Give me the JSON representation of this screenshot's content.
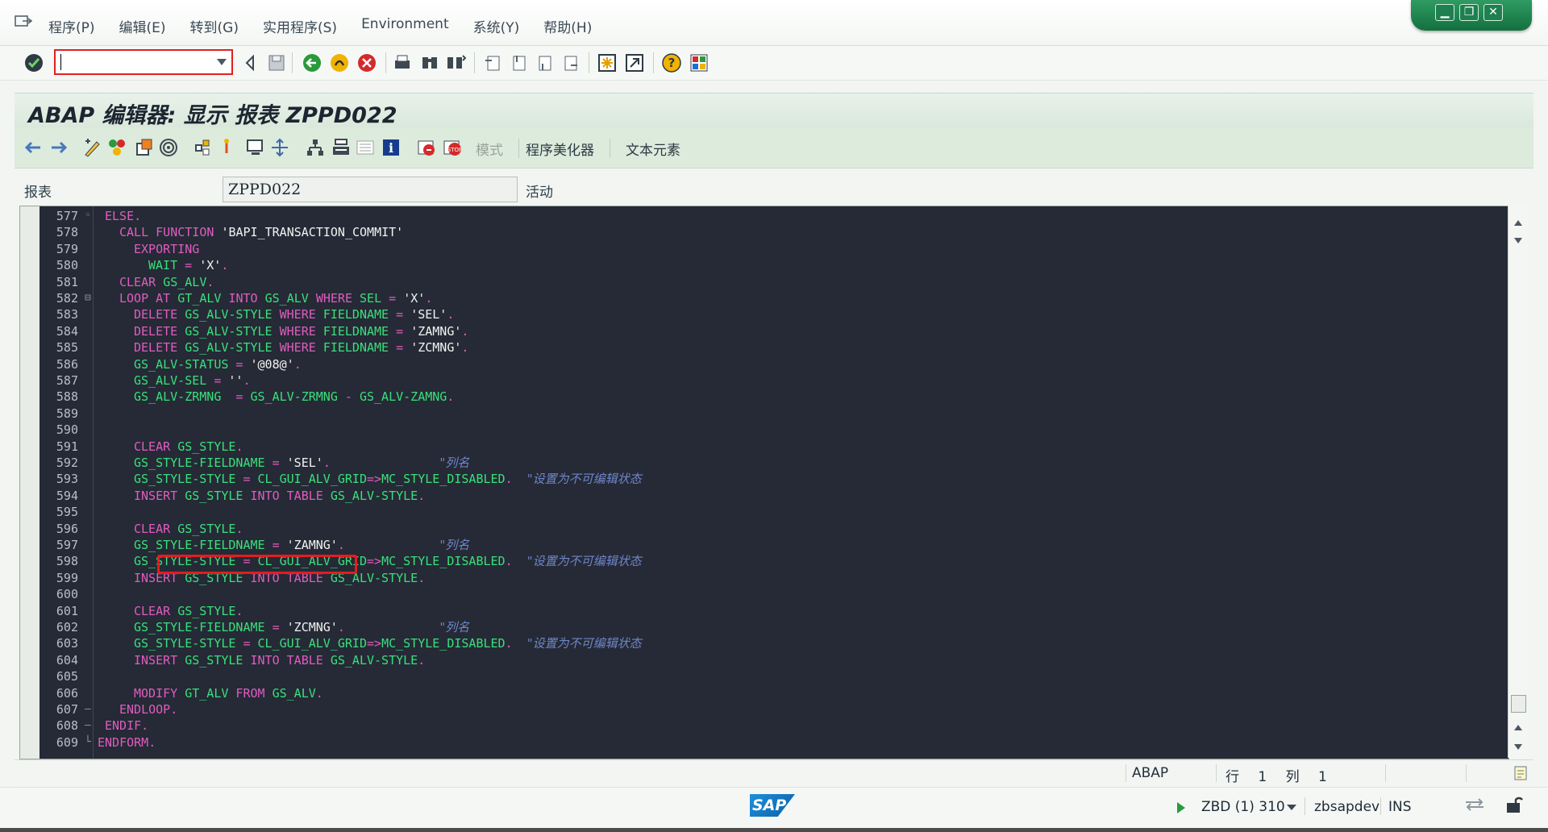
{
  "menu": {
    "items": [
      "程序(P)",
      "编辑(E)",
      "转到(G)",
      "实用程序(S)",
      "Environment",
      "系统(Y)",
      "帮助(H)"
    ]
  },
  "window_controls": {
    "minimize": "▁",
    "restore": "❐",
    "close": "✕"
  },
  "command_field": {
    "value": ""
  },
  "title": "ABAP 编辑器: 显示 报表 ZPPD022",
  "app_toolbar": {
    "mode_label": "模式",
    "pretty_printer_label": "程序美化器",
    "text_elements_label": "文本元素"
  },
  "header": {
    "label": "报表",
    "program_name": "ZPPD022",
    "status": "活动"
  },
  "code_lines": [
    {
      "n": "577",
      "fold": "◦",
      "indent": 1,
      "parts": [
        {
          "t": "kw",
          "v": "ELSE."
        }
      ]
    },
    {
      "n": "578",
      "fold": "",
      "indent": 3,
      "parts": [
        {
          "t": "kw",
          "v": "CALL FUNCTION "
        },
        {
          "t": "str",
          "v": "'BAPI_TRANSACTION_COMMIT'"
        }
      ]
    },
    {
      "n": "579",
      "fold": "",
      "indent": 5,
      "parts": [
        {
          "t": "kw",
          "v": "EXPORTING"
        }
      ]
    },
    {
      "n": "580",
      "fold": "",
      "indent": 7,
      "parts": [
        {
          "t": "id",
          "v": "WAIT"
        },
        {
          "t": "kw",
          "v": " = "
        },
        {
          "t": "str",
          "v": "'X'"
        },
        {
          "t": "kw",
          "v": "."
        }
      ]
    },
    {
      "n": "581",
      "fold": "",
      "indent": 3,
      "parts": [
        {
          "t": "kw",
          "v": "CLEAR "
        },
        {
          "t": "id",
          "v": "GS_ALV"
        },
        {
          "t": "kw",
          "v": "."
        }
      ]
    },
    {
      "n": "582",
      "fold": "⊟",
      "indent": 3,
      "parts": [
        {
          "t": "kw",
          "v": "LOOP AT "
        },
        {
          "t": "id",
          "v": "GT_ALV"
        },
        {
          "t": "kw",
          "v": " INTO "
        },
        {
          "t": "id",
          "v": "GS_ALV"
        },
        {
          "t": "kw",
          "v": " WHERE "
        },
        {
          "t": "id",
          "v": "SEL"
        },
        {
          "t": "kw",
          "v": " = "
        },
        {
          "t": "str",
          "v": "'X'"
        },
        {
          "t": "kw",
          "v": "."
        }
      ]
    },
    {
      "n": "583",
      "fold": "",
      "indent": 5,
      "parts": [
        {
          "t": "kw",
          "v": "DELETE "
        },
        {
          "t": "id",
          "v": "GS_ALV-STYLE"
        },
        {
          "t": "kw",
          "v": " WHERE "
        },
        {
          "t": "id",
          "v": "FIELDNAME"
        },
        {
          "t": "kw",
          "v": " = "
        },
        {
          "t": "str",
          "v": "'SEL'"
        },
        {
          "t": "kw",
          "v": "."
        }
      ]
    },
    {
      "n": "584",
      "fold": "",
      "indent": 5,
      "parts": [
        {
          "t": "kw",
          "v": "DELETE "
        },
        {
          "t": "id",
          "v": "GS_ALV-STYLE"
        },
        {
          "t": "kw",
          "v": " WHERE "
        },
        {
          "t": "id",
          "v": "FIELDNAME"
        },
        {
          "t": "kw",
          "v": " = "
        },
        {
          "t": "str",
          "v": "'ZAMNG'"
        },
        {
          "t": "kw",
          "v": "."
        }
      ]
    },
    {
      "n": "585",
      "fold": "",
      "indent": 5,
      "parts": [
        {
          "t": "kw",
          "v": "DELETE "
        },
        {
          "t": "id",
          "v": "GS_ALV-STYLE"
        },
        {
          "t": "kw",
          "v": " WHERE "
        },
        {
          "t": "id",
          "v": "FIELDNAME"
        },
        {
          "t": "kw",
          "v": " = "
        },
        {
          "t": "str",
          "v": "'ZCMNG'"
        },
        {
          "t": "kw",
          "v": "."
        }
      ]
    },
    {
      "n": "586",
      "fold": "",
      "indent": 5,
      "parts": [
        {
          "t": "id",
          "v": "GS_ALV-STATUS"
        },
        {
          "t": "kw",
          "v": " = "
        },
        {
          "t": "str",
          "v": "'@08@'"
        },
        {
          "t": "kw",
          "v": "."
        }
      ]
    },
    {
      "n": "587",
      "fold": "",
      "indent": 5,
      "parts": [
        {
          "t": "id",
          "v": "GS_ALV-SEL"
        },
        {
          "t": "kw",
          "v": " = "
        },
        {
          "t": "str",
          "v": "''"
        },
        {
          "t": "kw",
          "v": "."
        }
      ]
    },
    {
      "n": "588",
      "fold": "",
      "indent": 5,
      "parts": [
        {
          "t": "id",
          "v": "GS_ALV-ZRMNG"
        },
        {
          "t": "kw",
          "v": "  = "
        },
        {
          "t": "id",
          "v": "GS_ALV-ZRMNG"
        },
        {
          "t": "kw",
          "v": " - "
        },
        {
          "t": "id",
          "v": "GS_ALV-ZAMNG"
        },
        {
          "t": "kw",
          "v": "."
        }
      ]
    },
    {
      "n": "589",
      "fold": "",
      "indent": 0,
      "parts": []
    },
    {
      "n": "590",
      "fold": "",
      "indent": 0,
      "parts": []
    },
    {
      "n": "591",
      "fold": "",
      "indent": 5,
      "parts": [
        {
          "t": "kw",
          "v": "CLEAR "
        },
        {
          "t": "id",
          "v": "GS_STYLE"
        },
        {
          "t": "kw",
          "v": "."
        }
      ]
    },
    {
      "n": "592",
      "fold": "",
      "indent": 5,
      "parts": [
        {
          "t": "id",
          "v": "GS_STYLE-FIELDNAME"
        },
        {
          "t": "kw",
          "v": " = "
        },
        {
          "t": "str",
          "v": "'SEL'"
        },
        {
          "t": "kw",
          "v": ".               "
        },
        {
          "t": "cmt",
          "v": "\"列名"
        }
      ]
    },
    {
      "n": "593",
      "fold": "",
      "indent": 5,
      "parts": [
        {
          "t": "id",
          "v": "GS_STYLE-STYLE"
        },
        {
          "t": "kw",
          "v": " = "
        },
        {
          "t": "id",
          "v": "CL_GUI_ALV_GRID"
        },
        {
          "t": "kw",
          "v": "=>"
        },
        {
          "t": "id",
          "v": "MC_STYLE_DISABLED"
        },
        {
          "t": "kw",
          "v": ".  "
        },
        {
          "t": "cmt",
          "v": "\"设置为不可编辑状态"
        }
      ]
    },
    {
      "n": "594",
      "fold": "",
      "indent": 5,
      "parts": [
        {
          "t": "kw",
          "v": "INSERT "
        },
        {
          "t": "id",
          "v": "GS_STYLE"
        },
        {
          "t": "kw",
          "v": " INTO TABLE "
        },
        {
          "t": "id",
          "v": "GS_ALV-STYLE"
        },
        {
          "t": "kw",
          "v": "."
        }
      ]
    },
    {
      "n": "595",
      "fold": "",
      "indent": 0,
      "parts": []
    },
    {
      "n": "596",
      "fold": "",
      "indent": 5,
      "parts": [
        {
          "t": "kw",
          "v": "CLEAR "
        },
        {
          "t": "id",
          "v": "GS_STYLE"
        },
        {
          "t": "kw",
          "v": "."
        }
      ]
    },
    {
      "n": "597",
      "fold": "",
      "indent": 5,
      "parts": [
        {
          "t": "id",
          "v": "GS_STYLE-FIELDNAME"
        },
        {
          "t": "kw",
          "v": " = "
        },
        {
          "t": "str",
          "v": "'ZAMNG'"
        },
        {
          "t": "kw",
          "v": ".             "
        },
        {
          "t": "cmt",
          "v": "\"列名"
        }
      ]
    },
    {
      "n": "598",
      "fold": "",
      "indent": 5,
      "parts": [
        {
          "t": "id",
          "v": "GS_STYLE-STYLE"
        },
        {
          "t": "kw",
          "v": " = "
        },
        {
          "t": "id",
          "v": "CL_GUI_ALV_GRID"
        },
        {
          "t": "kw",
          "v": "=>"
        },
        {
          "t": "id",
          "v": "MC_STYLE_DISABLED"
        },
        {
          "t": "kw",
          "v": ".  "
        },
        {
          "t": "cmt",
          "v": "\"设置为不可编辑状态"
        }
      ]
    },
    {
      "n": "599",
      "fold": "",
      "indent": 5,
      "parts": [
        {
          "t": "kw",
          "v": "INSERT "
        },
        {
          "t": "id",
          "v": "GS_STYLE"
        },
        {
          "t": "kw",
          "v": " INTO TABLE "
        },
        {
          "t": "id",
          "v": "GS_ALV-STYLE"
        },
        {
          "t": "kw",
          "v": "."
        }
      ]
    },
    {
      "n": "600",
      "fold": "",
      "indent": 0,
      "parts": []
    },
    {
      "n": "601",
      "fold": "",
      "indent": 5,
      "parts": [
        {
          "t": "kw",
          "v": "CLEAR "
        },
        {
          "t": "id",
          "v": "GS_STYLE"
        },
        {
          "t": "kw",
          "v": "."
        }
      ]
    },
    {
      "n": "602",
      "fold": "",
      "indent": 5,
      "parts": [
        {
          "t": "id",
          "v": "GS_STYLE-FIELDNAME"
        },
        {
          "t": "kw",
          "v": " = "
        },
        {
          "t": "str",
          "v": "'ZCMNG'"
        },
        {
          "t": "kw",
          "v": ".             "
        },
        {
          "t": "cmt",
          "v": "\"列名"
        }
      ]
    },
    {
      "n": "603",
      "fold": "",
      "indent": 5,
      "parts": [
        {
          "t": "id",
          "v": "GS_STYLE-STYLE"
        },
        {
          "t": "kw",
          "v": " = "
        },
        {
          "t": "id",
          "v": "CL_GUI_ALV_GRID"
        },
        {
          "t": "kw",
          "v": "=>"
        },
        {
          "t": "id",
          "v": "MC_STYLE_DISABLED"
        },
        {
          "t": "kw",
          "v": ".  "
        },
        {
          "t": "cmt",
          "v": "\"设置为不可编辑状态"
        }
      ]
    },
    {
      "n": "604",
      "fold": "",
      "indent": 5,
      "parts": [
        {
          "t": "kw",
          "v": "INSERT "
        },
        {
          "t": "id",
          "v": "GS_STYLE"
        },
        {
          "t": "kw",
          "v": " INTO TABLE "
        },
        {
          "t": "id",
          "v": "GS_ALV-STYLE"
        },
        {
          "t": "kw",
          "v": "."
        }
      ]
    },
    {
      "n": "605",
      "fold": "",
      "indent": 0,
      "parts": []
    },
    {
      "n": "606",
      "fold": "",
      "indent": 5,
      "parts": [
        {
          "t": "kw",
          "v": "MODIFY "
        },
        {
          "t": "id",
          "v": "GT_ALV"
        },
        {
          "t": "kw",
          "v": " FROM "
        },
        {
          "t": "id",
          "v": "GS_ALV"
        },
        {
          "t": "kw",
          "v": "."
        }
      ]
    },
    {
      "n": "607",
      "fold": "–",
      "indent": 3,
      "parts": [
        {
          "t": "kw",
          "v": "ENDLOOP."
        }
      ]
    },
    {
      "n": "608",
      "fold": "–",
      "indent": 1,
      "parts": [
        {
          "t": "kw",
          "v": "ENDIF."
        }
      ]
    },
    {
      "n": "609",
      "fold": "└",
      "indent": 0,
      "parts": [
        {
          "t": "kw",
          "v": "ENDFORM."
        }
      ]
    }
  ],
  "editor_status": {
    "language": "ABAP",
    "row_label": "行",
    "row_value": "1",
    "col_label": "列",
    "col_value": "1"
  },
  "status_bar": {
    "logo": "SAP",
    "system": "ZBD (1) 310",
    "host": "zbsapdev",
    "mode": "INS"
  },
  "colors": {
    "editor_bg": "#252a36",
    "keyword": "#e05cbf",
    "identifier": "#39e07a",
    "string": "#f2f2f2",
    "comment": "#6f86c8",
    "highlight_box": "#e51c1c"
  }
}
